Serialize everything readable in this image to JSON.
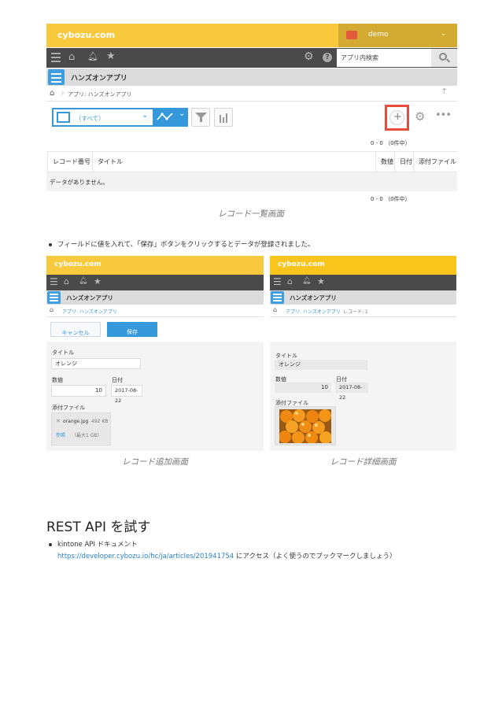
{
  "screen1": {
    "logo": "cybozu.com",
    "user": "demo",
    "search_placeholder": "アプリ内検索",
    "app_title": "ハンズオンアプリ",
    "breadcrumb": "アプリ: ハンズオンアプリ",
    "view_select": "（すべて）",
    "count_top": "0 - 0 （0件中）",
    "count_bottom": "0 - 0 （0件中）",
    "columns": [
      "レコード番号",
      "タイトル",
      "数値",
      "日付",
      "添付ファイル"
    ],
    "empty_message": "データがありません。"
  },
  "caption1": "レコード一覧画面",
  "bullet1": "フィールドに値を入れて、「保存」ボタンをクリックするとデータが登録されました。",
  "screen2": {
    "logo": "cybozu.com",
    "app_title": "ハンズオンアプリ",
    "breadcrumb": "アプリ: ハンズオンアプリ",
    "cancel_label": "キャンセル",
    "save_label": "保存",
    "title_label": "タイトル",
    "title_value": "オレンジ",
    "number_label": "数値",
    "number_value": "10",
    "date_label": "日付",
    "date_value": "2017-08-22",
    "attach_label": "添付ファイル",
    "file_name": "orange.jpg",
    "file_size": "492 KB",
    "browse_label": "参照",
    "max_size": "（最大1 GB）"
  },
  "caption2": "レコード追加画面",
  "screen3": {
    "logo": "cybozu.com",
    "app_title": "ハンズオンアプリ",
    "breadcrumb": "アプリ: ハンズオンアプリ",
    "breadcrumb_record": "レコード: 1",
    "title_label": "タイトル",
    "title_value": "オレンジ",
    "number_label": "数値",
    "number_value": "10",
    "date_label": "日付",
    "date_value": "2017-08-22",
    "attach_label": "添付ファイル"
  },
  "caption3": "レコード詳細画面",
  "heading": "REST API を試す",
  "bullet2_line1": "kintone API ドキュメント",
  "bullet2_link": "https://developer.cybozu.io/hc/ja/articles/201941754",
  "bullet2_suffix": " にアクセス（よく使うのでブックマークしましょう）",
  "colors": {
    "kintone_yellow": "#f8c93d",
    "dark_bar": "#4a4a4a",
    "blue": "#3498db",
    "highlight_red": "#e74c3c"
  }
}
